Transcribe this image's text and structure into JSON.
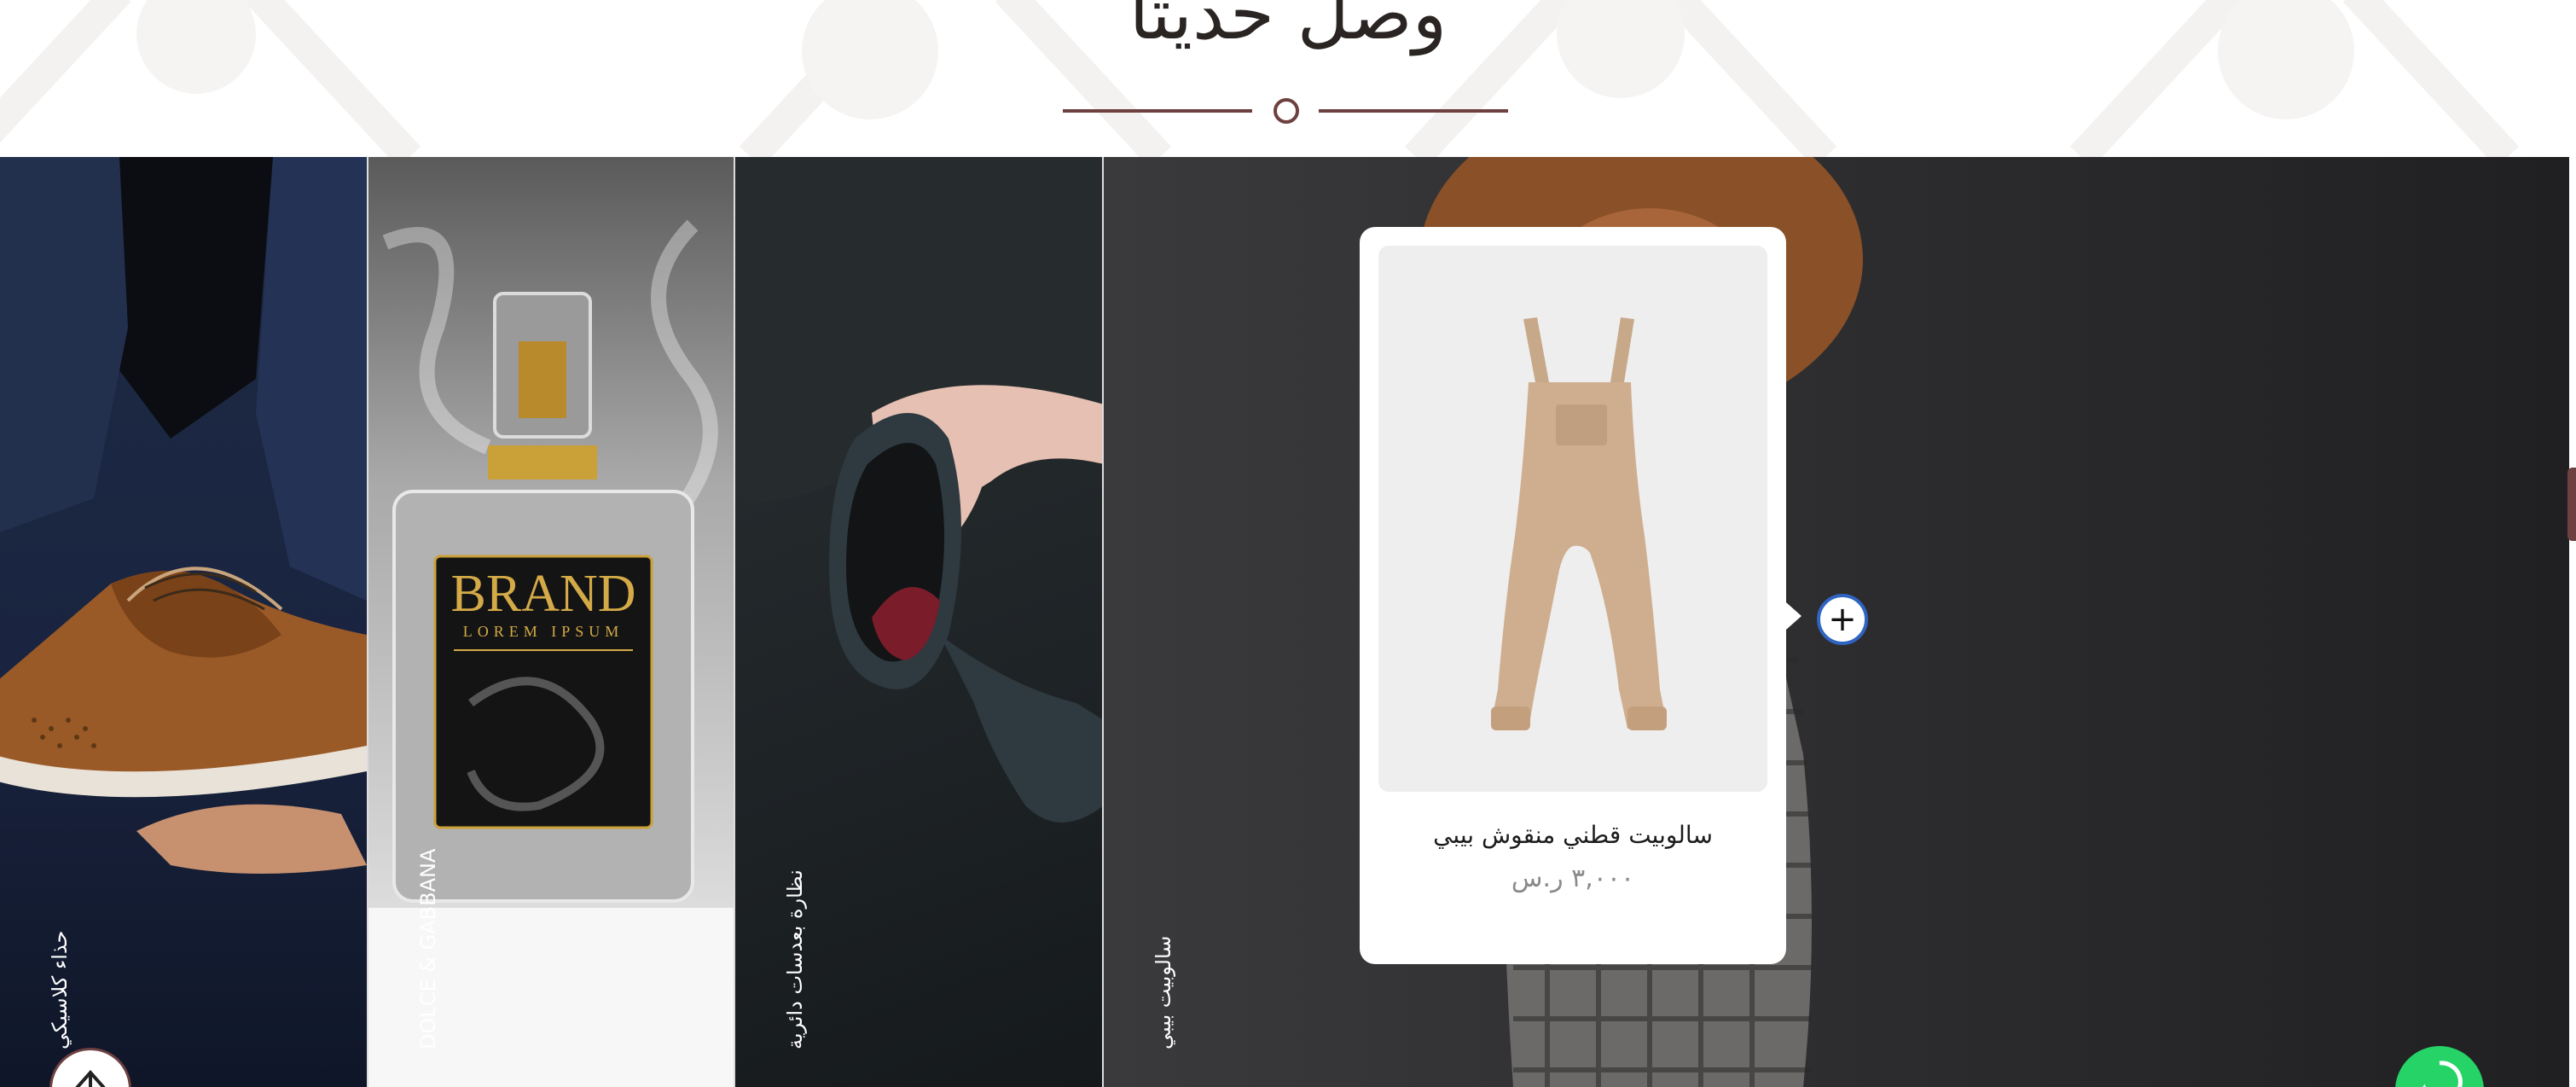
{
  "section": {
    "title": "وصل حديثا"
  },
  "panels": [
    {
      "id": "shoe",
      "label": "حذاء كلاسيكي"
    },
    {
      "id": "perfume",
      "label": "DOLCE & GABBANA"
    },
    {
      "id": "glasses",
      "label": "نظارة بعدسات دائرية"
    },
    {
      "id": "baby",
      "label": "سالوبيت بيبي"
    }
  ],
  "perfume_art": {
    "brand": "BRAND",
    "tagline": "LOREM IPSUM"
  },
  "product_card": {
    "name": "سالوبيت قطني منقوش بيبي",
    "price": "٣,٠٠٠ ر.س"
  },
  "colors": {
    "accent": "#6e4040",
    "hotspot_border": "#2f64c0",
    "whatsapp": "#25d366"
  },
  "icons": {
    "hotspot": "plus-icon",
    "back_to_top": "arrow-up-icon",
    "chat": "whatsapp-icon"
  }
}
